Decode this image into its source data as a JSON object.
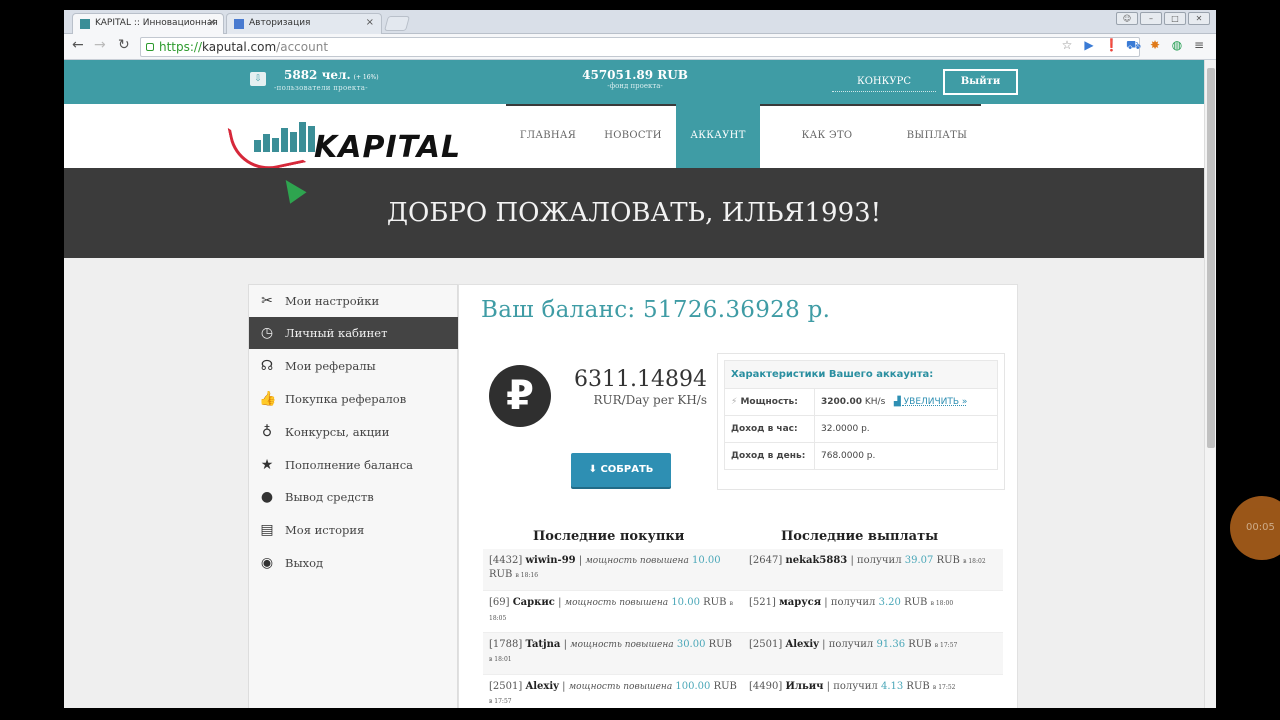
{
  "browser": {
    "tabs": [
      {
        "label": "KAPITAL :: Инновационная",
        "active": true
      },
      {
        "label": "Авторизация",
        "active": false
      }
    ],
    "url_scheme": "https://",
    "url_host": "kaputal.com",
    "url_path": "/account"
  },
  "topbar": {
    "users_count": "5882 чел.",
    "users_delta": "(+ 16%)",
    "users_label": "-пользователи проекта-",
    "fund_amount": "457051.89 RUB",
    "fund_label": "-фонд проекта-",
    "contest": "КОНКУРС",
    "logout": "Выйти"
  },
  "logo": {
    "text": "KAPITAL"
  },
  "menu": [
    {
      "label": "ГЛАВНАЯ",
      "active": false
    },
    {
      "label": "НОВОСТИ",
      "active": false
    },
    {
      "label": "АККАУНТ",
      "active": true
    },
    {
      "label": "КАК ЭТО РАБОТАЕТ",
      "active": false
    },
    {
      "label": "ВЫПЛАТЫ",
      "active": false
    }
  ],
  "welcome": "ДОБРО ПОЖАЛОВАТЬ, ИЛЬЯ1993!",
  "sidebar": [
    {
      "label": "Мои настройки",
      "icon": "tools-icon",
      "active": false
    },
    {
      "label": "Личный кабинет",
      "icon": "clock-icon",
      "active": true
    },
    {
      "label": "Мои рефералы",
      "icon": "headset-icon",
      "active": false
    },
    {
      "label": "Покупка рефералов",
      "icon": "thumbs-up-icon",
      "active": false
    },
    {
      "label": "Конкурсы, акции",
      "icon": "award-icon",
      "active": false
    },
    {
      "label": "Пополнение баланса",
      "icon": "star-icon",
      "active": false
    },
    {
      "label": "Вывод средств",
      "icon": "coin-icon",
      "active": false
    },
    {
      "label": "Моя история",
      "icon": "history-icon",
      "active": false
    },
    {
      "label": "Выход",
      "icon": "globe-icon",
      "active": false
    }
  ],
  "account": {
    "balance": "Ваш баланс: 51726.36928 р.",
    "currency_symbol": "₽",
    "rate": "6311.14894",
    "rate_unit": "RUR/Day per KH/s",
    "collect_button": "СОБРАТЬ",
    "stats_title": "Характеристики Вашего аккаунта:",
    "power_label": "Мощность:",
    "power_value": "3200.00",
    "power_unit": "KH/s",
    "increase_link": "УВЕЛИЧИТЬ »",
    "hour_label": "Доход в час:",
    "hour_value": "32.0000 р.",
    "day_label": "Доход в день:",
    "day_value": "768.0000 р."
  },
  "purchases": {
    "title": "Последние покупки",
    "items": [
      {
        "id": "[4432]",
        "user": "wiwin-99",
        "text": "мощность повышена",
        "amount": "10.00",
        "cur": "RUB",
        "time": "в 18:16"
      },
      {
        "id": "[69]",
        "user": "Саркис",
        "text": "мощность повышена",
        "amount": "10.00",
        "cur": "RUB",
        "time": "в 18:05"
      },
      {
        "id": "[1788]",
        "user": "Tatjna",
        "text": "мощность повышена",
        "amount": "30.00",
        "cur": "RUB",
        "time": "в 18:01"
      },
      {
        "id": "[2501]",
        "user": "Alexiy",
        "text": "мощность повышена",
        "amount": "100.00",
        "cur": "RUB",
        "time": "в 17:57"
      }
    ]
  },
  "payouts": {
    "title": "Последние выплаты",
    "items": [
      {
        "id": "[2647]",
        "user": "nekak5883",
        "text": "получил",
        "amount": "39.07",
        "cur": "RUB",
        "time": "в 18:02"
      },
      {
        "id": "[521]",
        "user": "маруся",
        "text": "получил",
        "amount": "3.20",
        "cur": "RUB",
        "time": "в 18:00"
      },
      {
        "id": "[2501]",
        "user": "Alexiy",
        "text": "получил",
        "amount": "91.36",
        "cur": "RUB",
        "time": "в 17:57"
      },
      {
        "id": "[4490]",
        "user": "Ильич",
        "text": "получил",
        "amount": "4.13",
        "cur": "RUB",
        "time": "в 17:52"
      }
    ]
  },
  "overlay_circle": "00:05"
}
